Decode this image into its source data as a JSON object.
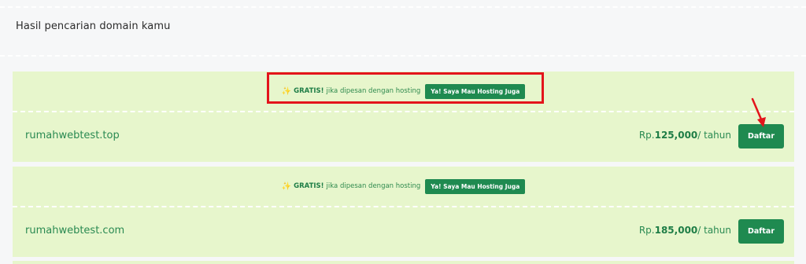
{
  "page": {
    "title": "Hasil pencarian domain kamu"
  },
  "results": [
    {
      "promo": {
        "sparkle": "✨",
        "gratis": "GRATIS!",
        "text": "jika dipesan dengan hosting",
        "button": "Ya! Saya Mau Hosting Juga"
      },
      "domain": "rumahwebtest.top",
      "price_prefix": "Rp.",
      "price_value": "125,000",
      "price_suffix": "/ tahun",
      "button": "Daftar"
    },
    {
      "promo": {
        "sparkle": "✨",
        "gratis": "GRATIS!",
        "text": "jika dipesan dengan hosting",
        "button": "Ya! Saya Mau Hosting Juga"
      },
      "domain": "rumahwebtest.com",
      "price_prefix": "Rp.",
      "price_value": "185,000",
      "price_suffix": "/ tahun",
      "button": "Daftar"
    }
  ],
  "annotations": {
    "highlight_color": "#e3141b",
    "arrow_color": "#e3141b"
  },
  "colors": {
    "card_bg": "#e7f6cc",
    "accent_green": "#1f8a50",
    "text_green": "#2a8a52"
  }
}
